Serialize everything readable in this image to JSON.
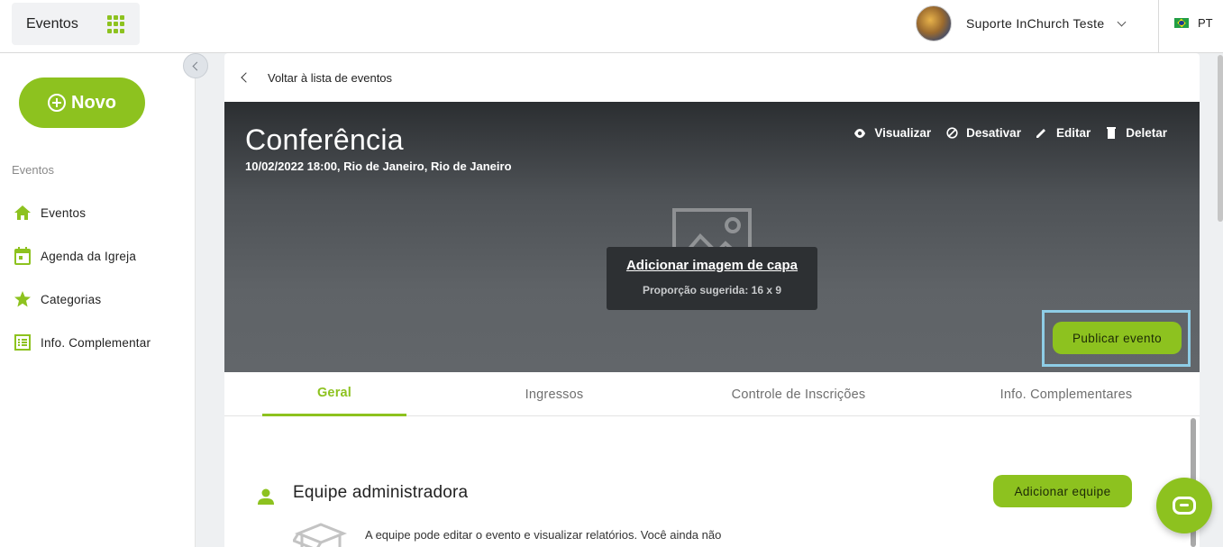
{
  "topbar": {
    "app_name": "Eventos",
    "apps_icon": "grid-icon",
    "user_name": "Suporte InChurch Teste",
    "language": "PT",
    "flag": "brazil-flag-icon"
  },
  "sidebar": {
    "new_button": "Novo",
    "section_label": "Eventos",
    "items": [
      {
        "label": "Eventos",
        "icon": "home-icon"
      },
      {
        "label": "Agenda da Igreja",
        "icon": "calendar-icon"
      },
      {
        "label": "Categorias",
        "icon": "star-icon"
      },
      {
        "label": "Info. Complementar",
        "icon": "list-icon"
      }
    ]
  },
  "main": {
    "back_label": "Voltar à lista de eventos",
    "event": {
      "title": "Conferência",
      "subtitle": "10/02/2022 18:00, Rio de Janeiro, Rio de Janeiro"
    },
    "actions": [
      {
        "label": "Visualizar",
        "icon": "eye-icon"
      },
      {
        "label": "Desativar",
        "icon": "block-icon"
      },
      {
        "label": "Editar",
        "icon": "pencil-icon"
      },
      {
        "label": "Deletar",
        "icon": "trash-icon"
      }
    ],
    "cover": {
      "link": "Adicionar imagem de capa",
      "hint": "Proporção sugerida: 16 x 9"
    },
    "publish_button": "Publicar evento",
    "tabs": [
      {
        "label": "Geral",
        "active": true
      },
      {
        "label": "Ingressos",
        "active": false
      },
      {
        "label": "Controle de Inscrições",
        "active": false
      },
      {
        "label": "Info. Complementares",
        "active": false
      }
    ],
    "team": {
      "title": "Equipe administradora",
      "add_button": "Adicionar equipe",
      "description": "A equipe pode editar o evento e visualizar relatórios. Você ainda não"
    }
  },
  "colors": {
    "accent": "#8dc21f",
    "highlight": "#8ecde6"
  }
}
